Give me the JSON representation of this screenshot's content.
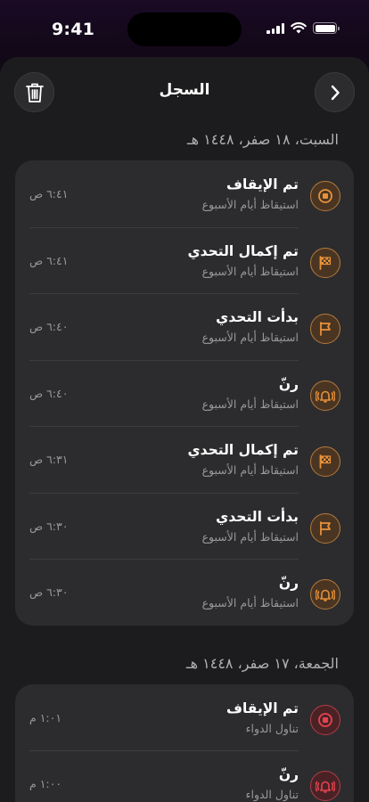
{
  "status_bar": {
    "time": "9:41"
  },
  "header": {
    "title": "السجل",
    "trash_icon": "trash-icon",
    "forward_icon": "chevron-right-icon"
  },
  "sections": [
    {
      "date": "السبت، ١٨ صفر، ١٤٤٨ هـ",
      "entries": [
        {
          "title": "تم الإيقاف",
          "subtitle": "استيقاظ أيام الأسبوع",
          "time": "٦:٤١ ص",
          "icon": "stop-icon",
          "color": "#e8913a"
        },
        {
          "title": "تم إكمال التحدي",
          "subtitle": "استيقاظ أيام الأسبوع",
          "time": "٦:٤١ ص",
          "icon": "checkered-flag-icon",
          "color": "#e8913a"
        },
        {
          "title": "بدأت التحدي",
          "subtitle": "استيقاظ أيام الأسبوع",
          "time": "٦:٤٠ ص",
          "icon": "flag-icon",
          "color": "#e8913a"
        },
        {
          "title": "رنّ",
          "subtitle": "استيقاظ أيام الأسبوع",
          "time": "٦:٤٠ ص",
          "icon": "ringing-bell-icon",
          "color": "#e8913a"
        },
        {
          "title": "تم إكمال التحدي",
          "subtitle": "استيقاظ أيام الأسبوع",
          "time": "٦:٣١ ص",
          "icon": "checkered-flag-icon",
          "color": "#e8913a"
        },
        {
          "title": "بدأت التحدي",
          "subtitle": "استيقاظ أيام الأسبوع",
          "time": "٦:٣٠ ص",
          "icon": "flag-icon",
          "color": "#e8913a"
        },
        {
          "title": "رنّ",
          "subtitle": "استيقاظ أيام الأسبوع",
          "time": "٦:٣٠ ص",
          "icon": "ringing-bell-icon",
          "color": "#e8913a"
        }
      ]
    },
    {
      "date": "الجمعة، ١٧ صفر، ١٤٤٨ هـ",
      "entries": [
        {
          "title": "تم الإيقاف",
          "subtitle": "تناول الدواء",
          "time": "١:٠١ م",
          "icon": "stop-icon",
          "color": "#e5444f"
        },
        {
          "title": "رنّ",
          "subtitle": "تناول الدواء",
          "time": "١:٠٠ م",
          "icon": "ringing-bell-icon",
          "color": "#e5444f"
        }
      ]
    }
  ]
}
